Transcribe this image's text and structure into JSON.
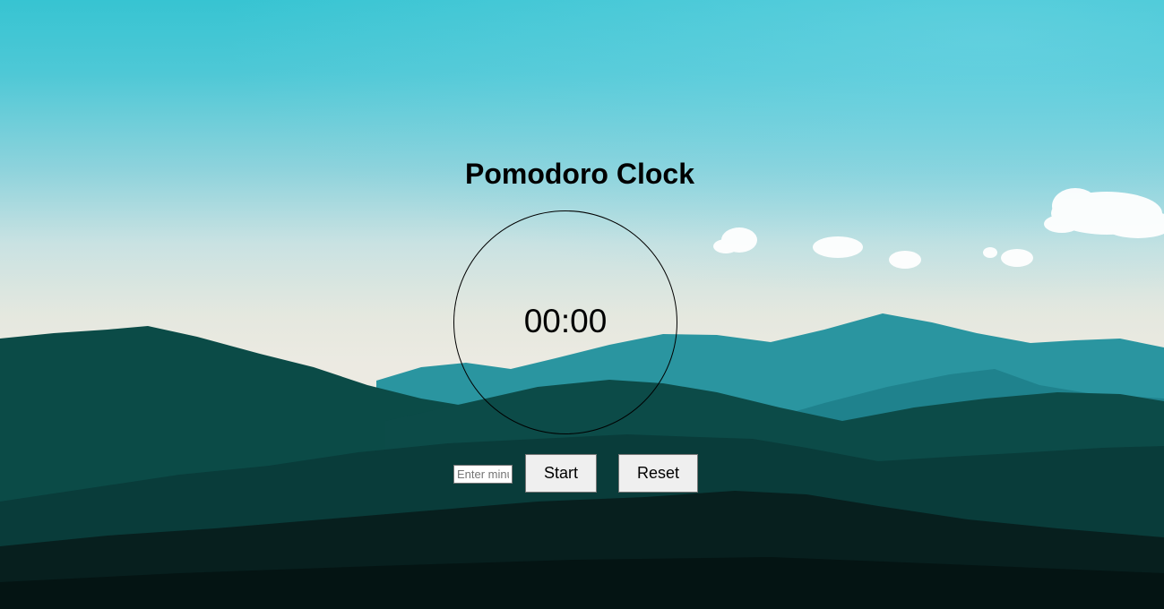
{
  "app": {
    "title": "Pomodoro Clock"
  },
  "clock": {
    "time": "00:00"
  },
  "controls": {
    "minutes_placeholder": "Enter minutes",
    "minutes_value": "",
    "start_label": "Start",
    "reset_label": "Reset"
  },
  "background": {
    "sky_top": "#37c4d2",
    "horizon": "#e8e9e3",
    "mountain_far": "#1f8d96",
    "mountain_near": "#0a3a36"
  }
}
